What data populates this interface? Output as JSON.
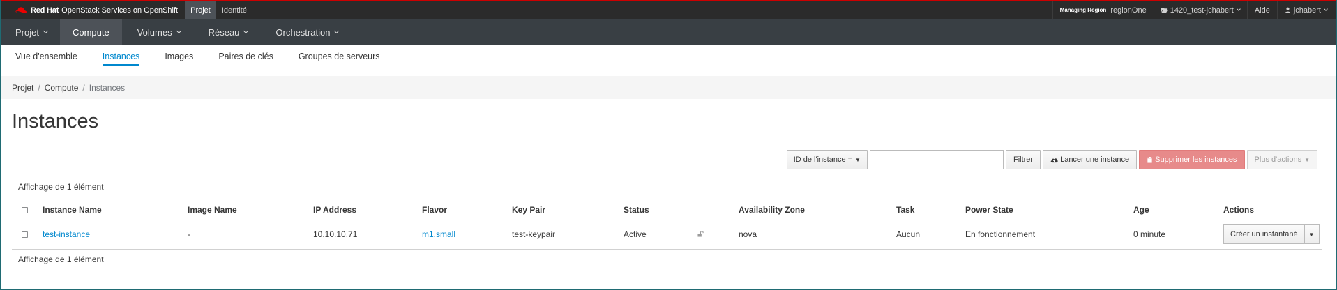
{
  "topbar": {
    "brand_redhat": "Red Hat",
    "brand_product": "OpenStack Services on OpenShift",
    "nav": [
      "Projet",
      "Identité"
    ],
    "managing_region_label": "Managing Region",
    "region": "regionOne",
    "project": "1420_test-jchabert",
    "help": "Aide",
    "user": "jchabert"
  },
  "mainnav": {
    "items": [
      "Projet",
      "Compute",
      "Volumes",
      "Réseau",
      "Orchestration"
    ],
    "active": "Compute"
  },
  "subnav": {
    "tabs": [
      "Vue d'ensemble",
      "Instances",
      "Images",
      "Paires de clés",
      "Groupes de serveurs"
    ],
    "active": "Instances"
  },
  "breadcrumb": [
    "Projet",
    "Compute",
    "Instances"
  ],
  "page_title": "Instances",
  "toolbar": {
    "filter_by": "ID de l'instance =",
    "search_value": "",
    "filter_button": "Filtrer",
    "launch_button": "Lancer une instance",
    "delete_button": "Supprimer les instances",
    "more_button": "Plus d'actions"
  },
  "table": {
    "count_text": "Affichage de 1 élément",
    "columns": [
      "Instance Name",
      "Image Name",
      "IP Address",
      "Flavor",
      "Key Pair",
      "Status",
      "",
      "Availability Zone",
      "Task",
      "Power State",
      "Age",
      "Actions"
    ],
    "rows": [
      {
        "instance_name": "test-instance",
        "image_name": "-",
        "ip_address": "10.10.10.71",
        "flavor": "m1.small",
        "key_pair": "test-keypair",
        "status": "Active",
        "lock_icon": "unlock-icon",
        "availability_zone": "nova",
        "task": "Aucun",
        "power_state": "En fonctionnement",
        "age": "0 minute",
        "action": "Créer un instantané"
      }
    ]
  },
  "colors": {
    "accent": "#0088ce",
    "brand_red": "#cc0000",
    "topbar": "#2b2b2b",
    "navbar": "#393f44",
    "danger": "#e78a8a"
  }
}
